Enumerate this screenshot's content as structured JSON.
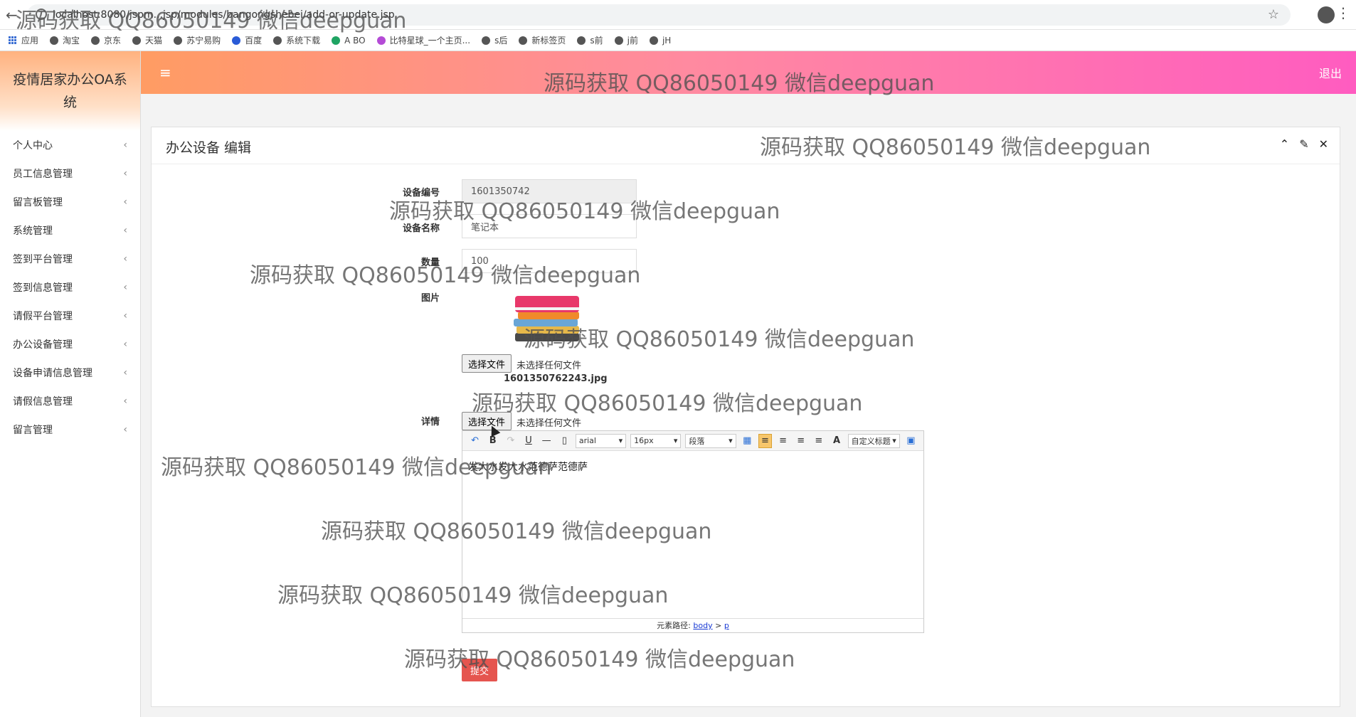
{
  "browser": {
    "url": "localhost:8080/jspm...jsp/modules/bangongshebei/add-or-update.jsp",
    "bookmarks": [
      "应用",
      "淘宝",
      "京东",
      "天猫",
      "苏宁易购",
      "百度",
      "系统下载",
      "A BO",
      "比特星球_一个主页...",
      "s后",
      "新标签页",
      "s前",
      "j前",
      "jH"
    ]
  },
  "app": {
    "title": "疫情居家办公OA系统",
    "logout": "退出",
    "menu_icon": "≡"
  },
  "sidebar": {
    "items": [
      {
        "label": "个人中心"
      },
      {
        "label": "员工信息管理"
      },
      {
        "label": "留言板管理"
      },
      {
        "label": "系统管理"
      },
      {
        "label": "签到平台管理"
      },
      {
        "label": "签到信息管理"
      },
      {
        "label": "请假平台管理"
      },
      {
        "label": "办公设备管理"
      },
      {
        "label": "设备申请信息管理"
      },
      {
        "label": "请假信息管理"
      },
      {
        "label": "留言管理"
      }
    ]
  },
  "panel": {
    "title": "办公设备 编辑"
  },
  "form": {
    "code_label": "设备编号",
    "code_value": "1601350742",
    "name_label": "设备名称",
    "name_value": "笔记本",
    "qty_label": "数量",
    "qty_value": "100",
    "image_label": "图片",
    "file_button": "选择文件",
    "file_note": "未选择任何文件",
    "image_filename": "1601350762243.jpg",
    "detail_label": "详情",
    "detail_file_button": "选择文件",
    "detail_file_note": "未选择任何文件",
    "submit": "提交"
  },
  "editor": {
    "font": "arial",
    "size": "16px",
    "paragraph": "段落",
    "custom_title": "自定义标题",
    "content": "发大水发大水范德萨范德萨",
    "path_label": "元素路径:",
    "path_body": "body",
    "path_sep": ">",
    "path_p": "p"
  },
  "watermark": "源码获取 QQ86050149 微信deepguan"
}
